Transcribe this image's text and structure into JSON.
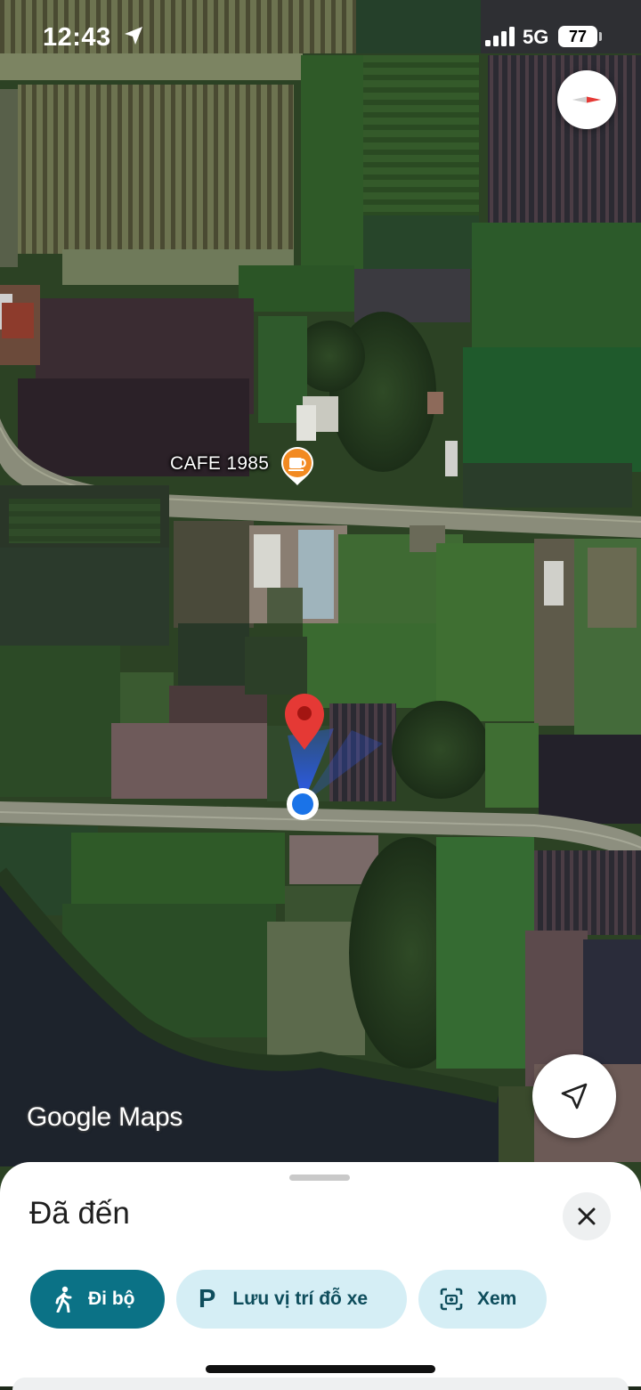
{
  "status_bar": {
    "time": "12:43",
    "network": "5G",
    "battery": "77"
  },
  "map": {
    "poi": {
      "name": "CAFE 1985",
      "icon": "coffee-cup-icon",
      "color": "#f28a22"
    },
    "logo": "Google Maps",
    "destination_pin_color": "#e53935",
    "my_location_color": "#1a73e8",
    "compass_icon": "compass-needle-icon",
    "recenter_icon": "navigation-arrow-icon"
  },
  "sheet": {
    "title": "Đã đến",
    "close_icon": "close-icon",
    "chips": [
      {
        "label": "Đi bộ",
        "icon": "walking-person-icon"
      },
      {
        "label": "Lưu vị trí đỗ xe",
        "icon": "parking-p-icon"
      },
      {
        "label": "Xem",
        "icon": "view-camera-icon"
      }
    ],
    "accent": "#0b7286",
    "chip_tint": "#d5eef5"
  }
}
